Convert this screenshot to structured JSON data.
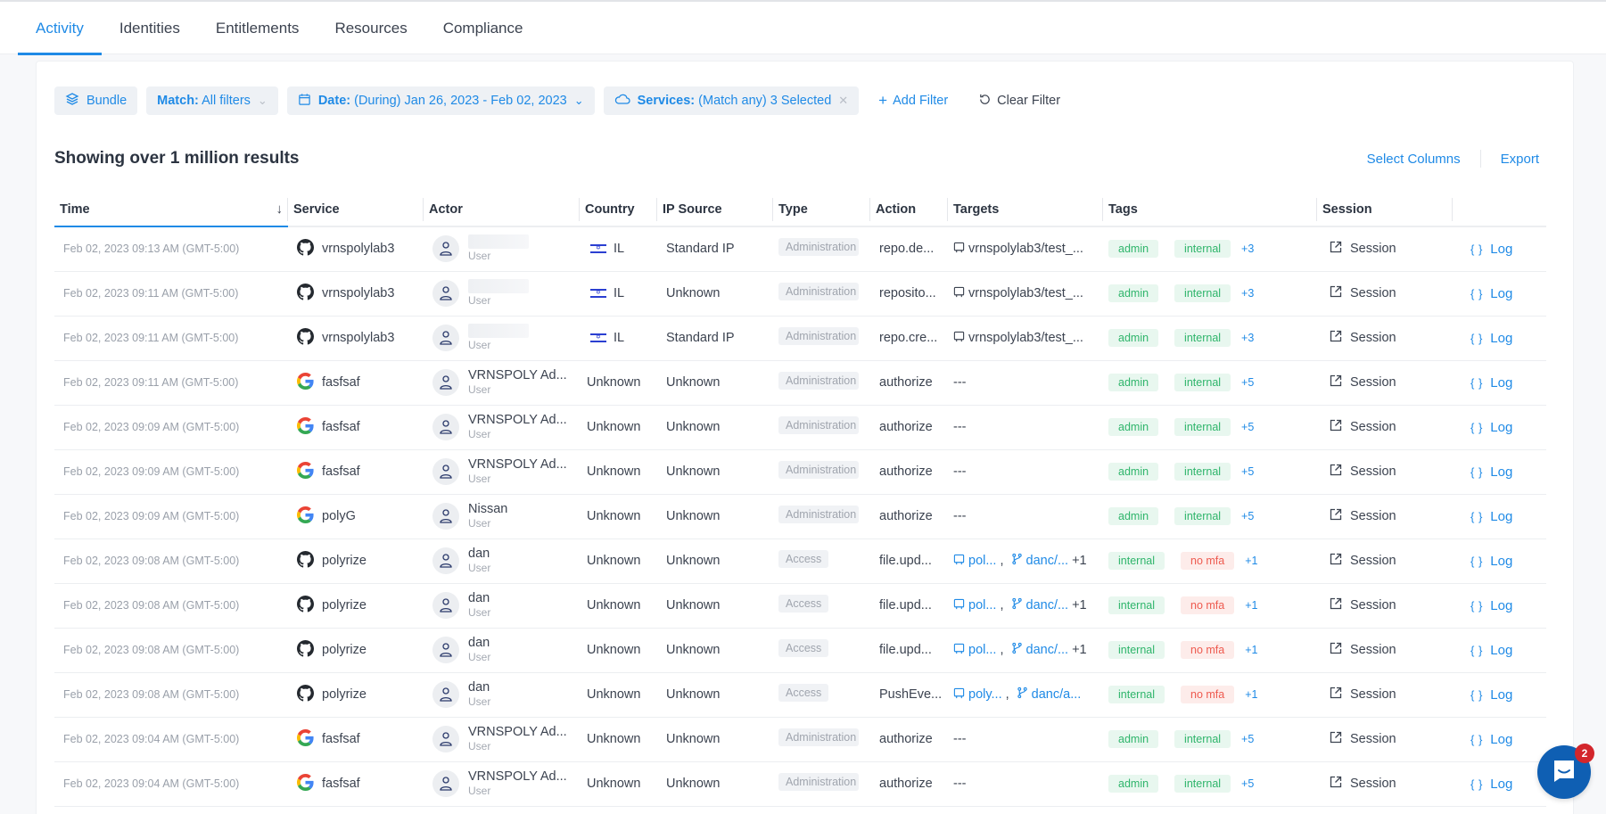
{
  "tabs": [
    {
      "label": "Activity",
      "active": true
    },
    {
      "label": "Identities",
      "active": false
    },
    {
      "label": "Entitlements",
      "active": false
    },
    {
      "label": "Resources",
      "active": false
    },
    {
      "label": "Compliance",
      "active": false
    }
  ],
  "filters": {
    "bundle_label": "Bundle",
    "match_key": "Match:",
    "match_value": "All filters",
    "date_key": "Date:",
    "date_value": "(During) Jan 26, 2023 - Feb 02, 2023",
    "services_key": "Services:",
    "services_value": "(Match any) 3 Selected",
    "add_filter_label": "Add Filter",
    "clear_filter_label": "Clear Filter"
  },
  "results": {
    "title": "Showing over 1 million results",
    "select_columns_label": "Select Columns",
    "export_label": "Export"
  },
  "columns": [
    "Time",
    "Service",
    "Actor",
    "Country",
    "IP Source",
    "Type",
    "Action",
    "Targets",
    "Tags",
    "Session",
    ""
  ],
  "rows": [
    {
      "time": "Feb 02, 2023 09:13 AM (GMT-5:00)",
      "service_icon": "github",
      "service": "vrnspolylab3",
      "actor": "",
      "actor_blurred": true,
      "actor_role": "User",
      "country": "IL",
      "has_flag": true,
      "ip_source": "Standard IP",
      "type": "Administration",
      "action": "repo.de...",
      "targets": [
        {
          "icon": "repo",
          "text": "vrnspolylab3/test_...",
          "link": false
        }
      ],
      "targets_more": "",
      "tags": [
        {
          "text": "admin",
          "color": "green"
        },
        {
          "text": "internal",
          "color": "green"
        }
      ],
      "tags_more": "+3",
      "session": "Session",
      "log": "Log"
    },
    {
      "time": "Feb 02, 2023 09:11 AM (GMT-5:00)",
      "service_icon": "github",
      "service": "vrnspolylab3",
      "actor": "",
      "actor_blurred": true,
      "actor_role": "User",
      "country": "IL",
      "has_flag": true,
      "ip_source": "Unknown",
      "type": "Administration",
      "action": "reposito...",
      "targets": [
        {
          "icon": "repo",
          "text": "vrnspolylab3/test_...",
          "link": false
        }
      ],
      "targets_more": "",
      "tags": [
        {
          "text": "admin",
          "color": "green"
        },
        {
          "text": "internal",
          "color": "green"
        }
      ],
      "tags_more": "+3",
      "session": "Session",
      "log": "Log"
    },
    {
      "time": "Feb 02, 2023 09:11 AM (GMT-5:00)",
      "service_icon": "github",
      "service": "vrnspolylab3",
      "actor": "",
      "actor_blurred": true,
      "actor_role": "User",
      "country": "IL",
      "has_flag": true,
      "ip_source": "Standard IP",
      "type": "Administration",
      "action": "repo.cre...",
      "targets": [
        {
          "icon": "repo",
          "text": "vrnspolylab3/test_...",
          "link": false
        }
      ],
      "targets_more": "",
      "tags": [
        {
          "text": "admin",
          "color": "green"
        },
        {
          "text": "internal",
          "color": "green"
        }
      ],
      "tags_more": "+3",
      "session": "Session",
      "log": "Log"
    },
    {
      "time": "Feb 02, 2023 09:11 AM (GMT-5:00)",
      "service_icon": "google",
      "service": "fasfsaf",
      "actor": "VRNSPOLY Ad...",
      "actor_blurred": false,
      "actor_role": "User",
      "country": "Unknown",
      "has_flag": false,
      "ip_source": "Unknown",
      "type": "Administration",
      "action": "authorize",
      "targets": [
        {
          "icon": "",
          "text": "---",
          "link": false
        }
      ],
      "targets_more": "",
      "tags": [
        {
          "text": "admin",
          "color": "green"
        },
        {
          "text": "internal",
          "color": "green"
        }
      ],
      "tags_more": "+5",
      "session": "Session",
      "log": "Log"
    },
    {
      "time": "Feb 02, 2023 09:09 AM (GMT-5:00)",
      "service_icon": "google",
      "service": "fasfsaf",
      "actor": "VRNSPOLY Ad...",
      "actor_blurred": false,
      "actor_role": "User",
      "country": "Unknown",
      "has_flag": false,
      "ip_source": "Unknown",
      "type": "Administration",
      "action": "authorize",
      "targets": [
        {
          "icon": "",
          "text": "---",
          "link": false
        }
      ],
      "targets_more": "",
      "tags": [
        {
          "text": "admin",
          "color": "green"
        },
        {
          "text": "internal",
          "color": "green"
        }
      ],
      "tags_more": "+5",
      "session": "Session",
      "log": "Log"
    },
    {
      "time": "Feb 02, 2023 09:09 AM (GMT-5:00)",
      "service_icon": "google",
      "service": "fasfsaf",
      "actor": "VRNSPOLY Ad...",
      "actor_blurred": false,
      "actor_role": "User",
      "country": "Unknown",
      "has_flag": false,
      "ip_source": "Unknown",
      "type": "Administration",
      "action": "authorize",
      "targets": [
        {
          "icon": "",
          "text": "---",
          "link": false
        }
      ],
      "targets_more": "",
      "tags": [
        {
          "text": "admin",
          "color": "green"
        },
        {
          "text": "internal",
          "color": "green"
        }
      ],
      "tags_more": "+5",
      "session": "Session",
      "log": "Log"
    },
    {
      "time": "Feb 02, 2023 09:09 AM (GMT-5:00)",
      "service_icon": "google",
      "service": "polyG",
      "actor": "Nissan",
      "actor_blurred": false,
      "actor_role": "User",
      "country": "Unknown",
      "has_flag": false,
      "ip_source": "Unknown",
      "type": "Administration",
      "action": "authorize",
      "targets": [
        {
          "icon": "",
          "text": "---",
          "link": false
        }
      ],
      "targets_more": "",
      "tags": [
        {
          "text": "admin",
          "color": "green"
        },
        {
          "text": "internal",
          "color": "green"
        }
      ],
      "tags_more": "+5",
      "session": "Session",
      "log": "Log"
    },
    {
      "time": "Feb 02, 2023 09:08 AM (GMT-5:00)",
      "service_icon": "github",
      "service": "polyrize",
      "actor": "dan",
      "actor_blurred": false,
      "actor_role": "User",
      "country": "Unknown",
      "has_flag": false,
      "ip_source": "Unknown",
      "type": "Access",
      "action": "file.upd...",
      "targets": [
        {
          "icon": "repo",
          "text": "pol...",
          "link": true
        },
        {
          "icon": "branch",
          "text": "danc/...",
          "link": true
        }
      ],
      "targets_more": "+1",
      "tags": [
        {
          "text": "internal",
          "color": "green"
        },
        {
          "text": "no mfa",
          "color": "red"
        }
      ],
      "tags_more": "+1",
      "session": "Session",
      "log": "Log"
    },
    {
      "time": "Feb 02, 2023 09:08 AM (GMT-5:00)",
      "service_icon": "github",
      "service": "polyrize",
      "actor": "dan",
      "actor_blurred": false,
      "actor_role": "User",
      "country": "Unknown",
      "has_flag": false,
      "ip_source": "Unknown",
      "type": "Access",
      "action": "file.upd...",
      "targets": [
        {
          "icon": "repo",
          "text": "pol...",
          "link": true
        },
        {
          "icon": "branch",
          "text": "danc/...",
          "link": true
        }
      ],
      "targets_more": "+1",
      "tags": [
        {
          "text": "internal",
          "color": "green"
        },
        {
          "text": "no mfa",
          "color": "red"
        }
      ],
      "tags_more": "+1",
      "session": "Session",
      "log": "Log"
    },
    {
      "time": "Feb 02, 2023 09:08 AM (GMT-5:00)",
      "service_icon": "github",
      "service": "polyrize",
      "actor": "dan",
      "actor_blurred": false,
      "actor_role": "User",
      "country": "Unknown",
      "has_flag": false,
      "ip_source": "Unknown",
      "type": "Access",
      "action": "file.upd...",
      "targets": [
        {
          "icon": "repo",
          "text": "pol...",
          "link": true
        },
        {
          "icon": "branch",
          "text": "danc/...",
          "link": true
        }
      ],
      "targets_more": "+1",
      "tags": [
        {
          "text": "internal",
          "color": "green"
        },
        {
          "text": "no mfa",
          "color": "red"
        }
      ],
      "tags_more": "+1",
      "session": "Session",
      "log": "Log"
    },
    {
      "time": "Feb 02, 2023 09:08 AM (GMT-5:00)",
      "service_icon": "github",
      "service": "polyrize",
      "actor": "dan",
      "actor_blurred": false,
      "actor_role": "User",
      "country": "Unknown",
      "has_flag": false,
      "ip_source": "Unknown",
      "type": "Access",
      "action": "PushEve...",
      "targets": [
        {
          "icon": "repo",
          "text": "poly...",
          "link": true
        },
        {
          "icon": "branch",
          "text": "danc/a...",
          "link": true
        }
      ],
      "targets_more": "",
      "tags": [
        {
          "text": "internal",
          "color": "green"
        },
        {
          "text": "no mfa",
          "color": "red"
        }
      ],
      "tags_more": "+1",
      "session": "Session",
      "log": "Log"
    },
    {
      "time": "Feb 02, 2023 09:04 AM (GMT-5:00)",
      "service_icon": "google",
      "service": "fasfsaf",
      "actor": "VRNSPOLY Ad...",
      "actor_blurred": false,
      "actor_role": "User",
      "country": "Unknown",
      "has_flag": false,
      "ip_source": "Unknown",
      "type": "Administration",
      "action": "authorize",
      "targets": [
        {
          "icon": "",
          "text": "---",
          "link": false
        }
      ],
      "targets_more": "",
      "tags": [
        {
          "text": "admin",
          "color": "green"
        },
        {
          "text": "internal",
          "color": "green"
        }
      ],
      "tags_more": "+5",
      "session": "Session",
      "log": "Log"
    },
    {
      "time": "Feb 02, 2023 09:04 AM (GMT-5:00)",
      "service_icon": "google",
      "service": "fasfsaf",
      "actor": "VRNSPOLY Ad...",
      "actor_blurred": false,
      "actor_role": "User",
      "country": "Unknown",
      "has_flag": false,
      "ip_source": "Unknown",
      "type": "Administration",
      "action": "authorize",
      "targets": [
        {
          "icon": "",
          "text": "---",
          "link": false
        }
      ],
      "targets_more": "",
      "tags": [
        {
          "text": "admin",
          "color": "green"
        },
        {
          "text": "internal",
          "color": "green"
        }
      ],
      "tags_more": "+5",
      "session": "Session",
      "log": "Log"
    }
  ],
  "chat": {
    "badge_count": "2"
  },
  "colors": {
    "accent": "#1f8ae6",
    "tag_green_bg": "#e8f7ef",
    "tag_green_text": "#2fb56b",
    "tag_red_bg": "#fdecea",
    "tag_red_text": "#ee5a4f",
    "chat_blue": "#0f5fb3",
    "badge_red": "#d3262c"
  }
}
